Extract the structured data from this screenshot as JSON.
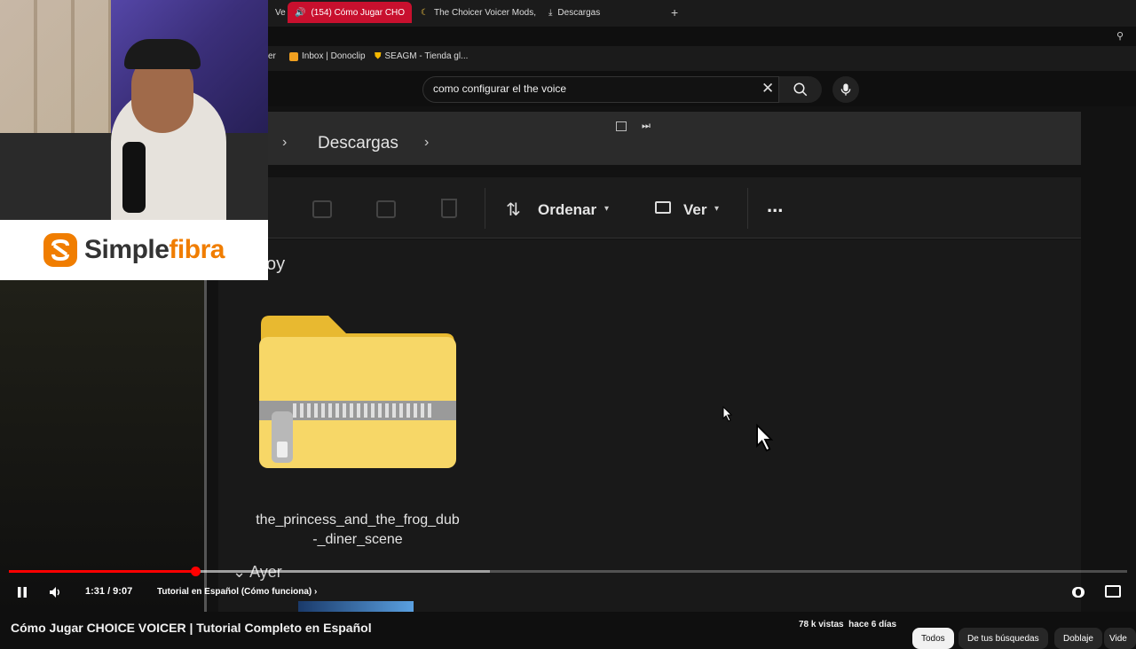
{
  "browser": {
    "tabs": [
      {
        "label": "(154) Cómo Jugar CHO",
        "active": true
      },
      {
        "label": "The Choicer Voicer Mods,"
      },
      {
        "label": "Descargas"
      }
    ],
    "partial_tab": "Ve",
    "new_tab_symbol": "+",
    "bookmarks": [
      {
        "label": "er"
      },
      {
        "label": "Inbox | Donoclip"
      },
      {
        "label": "SEAGM - Tienda gl..."
      }
    ]
  },
  "search": {
    "query": "como configurar el the voice"
  },
  "video_content": {
    "breadcrumb": "Descargas",
    "toolbar": {
      "sort_label": "Ordenar",
      "view_label": "Ver",
      "more_label": "..."
    },
    "group_today": "oy",
    "file_name_line1": "the_princess_and_the_frog_dub",
    "file_name_line2": "-_diner_scene",
    "group_yesterday": "Ayer"
  },
  "sponsor": {
    "brand_left": "Simple",
    "brand_right": "fibra",
    "colors": {
      "brand": "#f07d00",
      "text": "#333333"
    }
  },
  "player": {
    "time": "1:31 / 9:07",
    "chapter": "Tutorial en Español (Cómo funciona)",
    "progress": 0.167,
    "buffered": 0.43
  },
  "video_title": "Cómo Jugar CHOICE VOICER | Tutorial Completo en Español",
  "stats": "78 k vistas  hace 6 días",
  "chips": [
    {
      "label": "Todos",
      "selected": true
    },
    {
      "label": "De tus búsquedas"
    },
    {
      "label": "Doblaje"
    },
    {
      "label": "Vide"
    }
  ],
  "colors": {
    "accent": "#ff0000",
    "tab_active": "#c8102e"
  }
}
